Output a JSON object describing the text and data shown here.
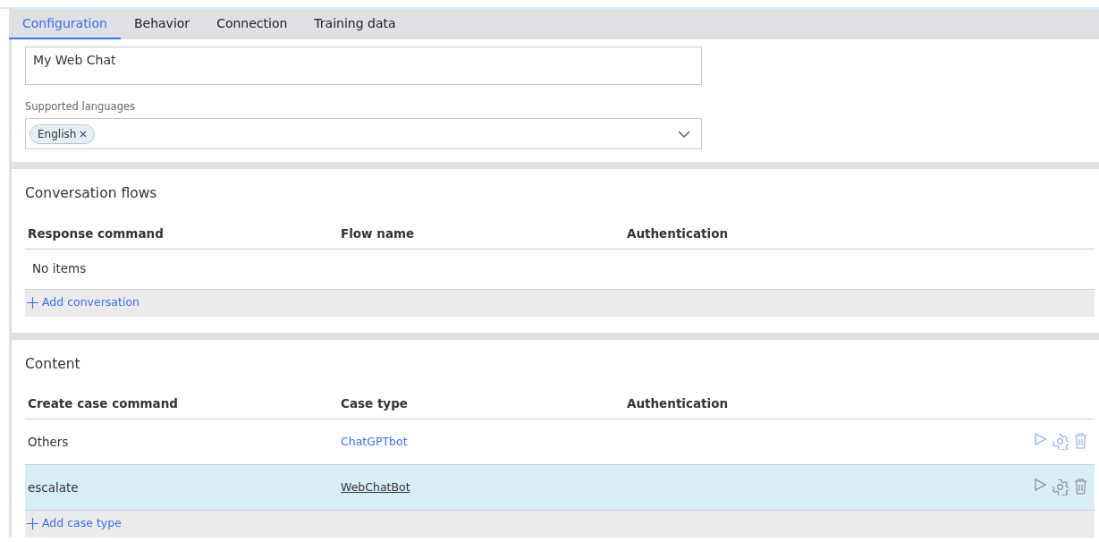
{
  "tabs": [
    {
      "label": "Configuration",
      "selected": true
    },
    {
      "label": "Behavior",
      "selected": false
    },
    {
      "label": "Connection",
      "selected": false
    },
    {
      "label": "Training data",
      "selected": false
    }
  ],
  "description_field": {
    "value": "My Web Chat"
  },
  "supported_languages": {
    "label": "Supported languages",
    "tags": [
      "English"
    ]
  },
  "conversation_flows": {
    "title": "Conversation flows",
    "columns": [
      "Response command",
      "Flow name",
      "Authentication"
    ],
    "empty_text": "No items",
    "add_label": "Add conversation"
  },
  "content": {
    "title": "Content",
    "columns": [
      "Create case command",
      "Case type",
      "Authentication"
    ],
    "rows": [
      {
        "command": "Others",
        "case_type": "ChatGPTbot",
        "selected": false
      },
      {
        "command": "escalate",
        "case_type": "WebChatBot",
        "selected": true
      }
    ],
    "add_label": "Add case type"
  }
}
